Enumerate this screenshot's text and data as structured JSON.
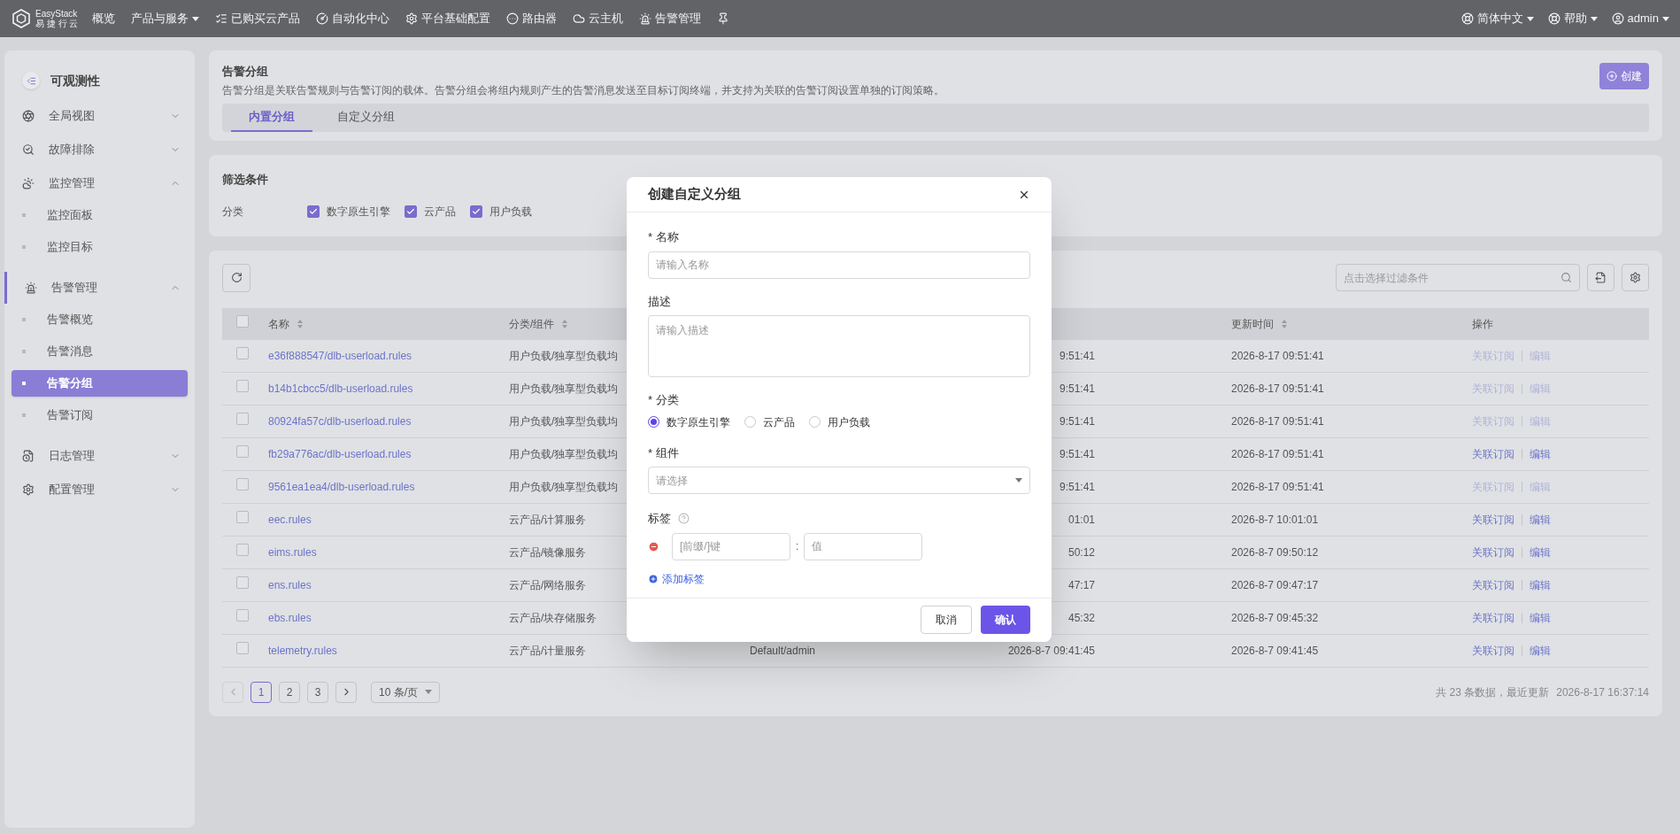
{
  "topbar": {
    "logo": {
      "name": "EasyStack",
      "subtitle": "易 捷 行 云"
    },
    "nav": [
      {
        "label": "概览",
        "dropdown": false
      },
      {
        "label": "产品与服务",
        "dropdown": true
      },
      {
        "label": "已购买云产品",
        "dropdown": false
      },
      {
        "label": "自动化中心",
        "dropdown": false
      },
      {
        "label": "平台基础配置",
        "dropdown": false
      },
      {
        "label": "路由器",
        "dropdown": false
      },
      {
        "label": "云主机",
        "dropdown": false
      },
      {
        "label": "告警管理",
        "dropdown": false
      }
    ],
    "right": [
      {
        "label": "简体中文"
      },
      {
        "label": "帮助"
      },
      {
        "label": "admin"
      }
    ]
  },
  "sidebar": {
    "title": "可观测性",
    "items": [
      {
        "label": "全局视图",
        "expanded": false,
        "active": false
      },
      {
        "label": "故障排除",
        "expanded": false,
        "active": false
      },
      {
        "label": "监控管理",
        "expanded": true,
        "active": false,
        "children": [
          {
            "label": "监控面板",
            "selected": false
          },
          {
            "label": "监控目标",
            "selected": false
          }
        ]
      },
      {
        "label": "告警管理",
        "expanded": true,
        "active": true,
        "children": [
          {
            "label": "告警概览",
            "selected": false
          },
          {
            "label": "告警消息",
            "selected": false
          },
          {
            "label": "告警分组",
            "selected": true
          },
          {
            "label": "告警订阅",
            "selected": false
          }
        ]
      },
      {
        "label": "日志管理",
        "expanded": false,
        "active": false
      },
      {
        "label": "配置管理",
        "expanded": false,
        "active": false
      }
    ]
  },
  "header": {
    "title": "告警分组",
    "description": "告警分组是关联告警规则与告警订阅的载体。告警分组会将组内规则产生的告警消息发送至目标订阅终端，并支持为关联的告警订阅设置单独的订阅策略。",
    "create_button": "创建",
    "tabs": [
      {
        "label": "内置分组",
        "selected": true
      },
      {
        "label": "自定义分组",
        "selected": false
      }
    ]
  },
  "filters": {
    "title": "筛选条件",
    "label": "分类",
    "options": [
      {
        "label": "数字原生引擎",
        "checked": true
      },
      {
        "label": "云产品",
        "checked": true
      },
      {
        "label": "用户负载",
        "checked": true
      }
    ]
  },
  "table": {
    "search": {
      "placeholder": "点击选择过滤条件"
    },
    "select_all_checked": false,
    "columns": [
      {
        "label": "名称",
        "sortable": true
      },
      {
        "label": "分类/组件",
        "sortable": true
      },
      {
        "label": "更新时间",
        "sortable": true
      },
      {
        "label": "操作",
        "sortable": false
      }
    ],
    "rows": [
      {
        "checked": false,
        "name": "e36f888547/dlb-userload.rules",
        "category": "用户负载/独享型负载均",
        "created": "9:51:41",
        "updated": "2026-8-17 09:51:41",
        "actions": [
          {
            "label": "关联订阅",
            "disabled": true
          },
          {
            "label": "编辑",
            "disabled": true
          }
        ]
      },
      {
        "checked": false,
        "name": "b14b1cbcc5/dlb-userload.rules",
        "category": "用户负载/独享型负载均",
        "created": "9:51:41",
        "updated": "2026-8-17 09:51:41",
        "actions": [
          {
            "label": "关联订阅",
            "disabled": true
          },
          {
            "label": "编辑",
            "disabled": true
          }
        ]
      },
      {
        "checked": false,
        "name": "80924fa57c/dlb-userload.rules",
        "category": "用户负载/独享型负载均",
        "created": "9:51:41",
        "updated": "2026-8-17 09:51:41",
        "actions": [
          {
            "label": "关联订阅",
            "disabled": true
          },
          {
            "label": "编辑",
            "disabled": true
          }
        ]
      },
      {
        "checked": false,
        "name": "fb29a776ac/dlb-userload.rules",
        "category": "用户负载/独享型负载均",
        "created": "9:51:41",
        "updated": "2026-8-17 09:51:41",
        "actions": [
          {
            "label": "关联订阅",
            "disabled": false
          },
          {
            "label": "编辑",
            "disabled": false
          }
        ]
      },
      {
        "checked": false,
        "name": "9561ea1ea4/dlb-userload.rules",
        "category": "用户负载/独享型负载均",
        "created": "9:51:41",
        "updated": "2026-8-17 09:51:41",
        "actions": [
          {
            "label": "关联订阅",
            "disabled": true
          },
          {
            "label": "编辑",
            "disabled": true
          }
        ]
      },
      {
        "checked": false,
        "name": "eec.rules",
        "category": "云产品/计算服务",
        "created": "01:01",
        "updated": "2026-8-7 10:01:01",
        "actions": [
          {
            "label": "关联订阅",
            "disabled": false
          },
          {
            "label": "编辑",
            "disabled": false
          }
        ]
      },
      {
        "checked": false,
        "name": "eims.rules",
        "category": "云产品/镜像服务",
        "created": "50:12",
        "updated": "2026-8-7 09:50:12",
        "actions": [
          {
            "label": "关联订阅",
            "disabled": false
          },
          {
            "label": "编辑",
            "disabled": false
          }
        ]
      },
      {
        "checked": false,
        "name": "ens.rules",
        "category": "云产品/网络服务",
        "created": "47:17",
        "updated": "2026-8-7 09:47:17",
        "actions": [
          {
            "label": "关联订阅",
            "disabled": false
          },
          {
            "label": "编辑",
            "disabled": false
          }
        ]
      },
      {
        "checked": false,
        "name": "ebs.rules",
        "category": "云产品/块存储服务",
        "created": "45:32",
        "updated": "2026-8-7 09:45:32",
        "actions": [
          {
            "label": "关联订阅",
            "disabled": false
          },
          {
            "label": "编辑",
            "disabled": false
          }
        ]
      },
      {
        "checked": false,
        "name": "telemetry.rules",
        "category": "云产品/计量服务",
        "owner": "Default/admin",
        "created": "2026-8-7 09:41:45",
        "updated": "2026-8-7 09:41:45",
        "actions": [
          {
            "label": "关联订阅",
            "disabled": false
          },
          {
            "label": "编辑",
            "disabled": false
          }
        ]
      }
    ],
    "pagination": {
      "pages": [
        {
          "label": "1",
          "selected": true
        },
        {
          "label": "2",
          "selected": false
        },
        {
          "label": "3",
          "selected": false
        }
      ],
      "prev_disabled": true,
      "page_size": "10 条/页"
    },
    "summary": "共 23 条数据，最近更新",
    "last_updated": "2026-8-17 16:37:14"
  },
  "modal": {
    "title": "创建自定义分组",
    "name": {
      "mark": "*",
      "label": "名称",
      "placeholder": "请输入名称"
    },
    "description": {
      "label": "描述",
      "placeholder": "请输入描述"
    },
    "category": {
      "mark": "*",
      "label": "分类",
      "options": [
        {
          "label": "数字原生引擎",
          "selected": true
        },
        {
          "label": "云产品",
          "selected": false
        },
        {
          "label": "用户负载",
          "selected": false
        }
      ]
    },
    "component": {
      "mark": "*",
      "label": "组件",
      "placeholder": "请选择"
    },
    "tags": {
      "label": "标签",
      "key_placeholder": "[前缀/]键",
      "separator": ":",
      "value_placeholder": "值",
      "add": "添加标签"
    },
    "buttons": {
      "cancel": "取消",
      "confirm": "确认"
    }
  }
}
